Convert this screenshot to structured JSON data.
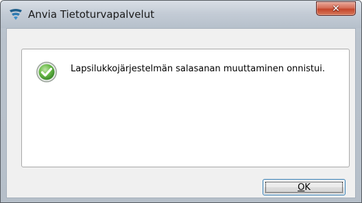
{
  "window": {
    "title": "Anvia Tietoturvapalvelut",
    "close_icon": "close-x-icon"
  },
  "message": {
    "icon": "success-check-icon",
    "text": "Lapsilukkojärjestelmän salasanan muuttaminen onnistui."
  },
  "buttons": {
    "ok_label": "OK"
  },
  "colors": {
    "close_button": "#c4462b",
    "check_green": "#4caf3a",
    "focus_border": "#3c7fb1"
  }
}
